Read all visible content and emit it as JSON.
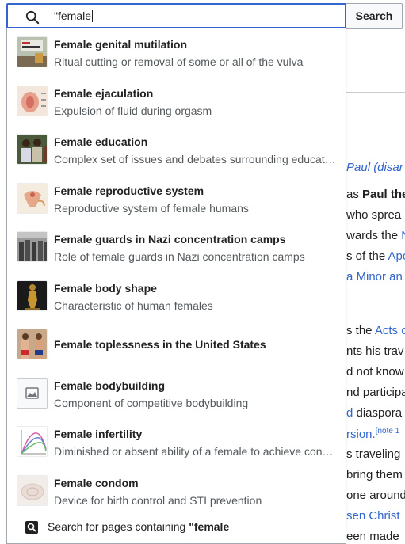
{
  "search": {
    "query_prefix": "\"",
    "query_underlined": "female",
    "button_label": "Search"
  },
  "suggestions": [
    {
      "title": "Female genital mutilation",
      "description": "Ritual cutting or removal of some or all of the vulva"
    },
    {
      "title": "Female ejaculation",
      "description": "Expulsion of fluid during orgasm"
    },
    {
      "title": "Female education",
      "description": "Complex set of issues and debates surrounding education (primary education, secondary education, tertiary education, and health education in particular) for girls and women"
    },
    {
      "title": "Female reproductive system",
      "description": "Reproductive system of female humans"
    },
    {
      "title": "Female guards in Nazi concentration camps",
      "description": "Role of female guards in Nazi concentration camps"
    },
    {
      "title": "Female body shape",
      "description": "Characteristic of human females"
    },
    {
      "title": "Female toplessness in the United States",
      "description": ""
    },
    {
      "title": "Female bodybuilding",
      "description": "Component of competitive bodybuilding"
    },
    {
      "title": "Female infertility",
      "description": "Diminished or absent ability of a female to achieve conception"
    },
    {
      "title": "Female condom",
      "description": "Device for birth control and STI prevention"
    }
  ],
  "footer": {
    "prefix": "Search for pages containing ",
    "query": "\"female"
  },
  "background_text": {
    "l1": "Paul (disar",
    "l2_pre": "as ",
    "l2_bold": "Paul the",
    "l3": " who sprea",
    "l4_pre": "wards the ",
    "l4_link": "N",
    "l5_pre": "s of the ",
    "l5_link": "Apo",
    "l6": "a Minor an",
    "l7_pre": "s the ",
    "l7_link": "Acts o",
    "l8": "nts his trav",
    "l9": "d not know",
    "l10": "nd participa",
    "l11_link": "d",
    "l11_post": " diaspora",
    "l12_link": "rsion.",
    "l12_sup": "[note 1",
    "l13": "s traveling",
    "l14": "bring them",
    "l15": "one around",
    "l16": "sen Christ",
    "l17": "een made"
  }
}
